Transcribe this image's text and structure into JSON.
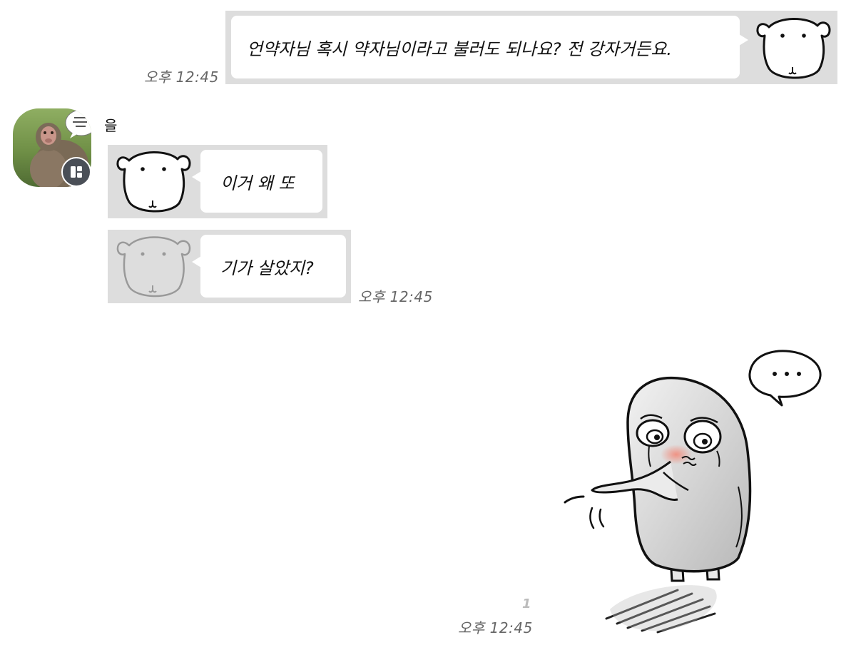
{
  "messages": {
    "outgoing_1": {
      "text": "언약자님 혹시 약자님이라고 불러도 되나요? 전 강자거든요.",
      "time": "오후 12:45"
    },
    "incoming": {
      "sender_name": "을",
      "message_1": "이거 왜 또",
      "message_2": "기가 살았지?",
      "time": "오후 12:45"
    },
    "sticker": {
      "unread_count": "1",
      "time": "오후 12:45"
    }
  },
  "colors": {
    "emote_background": "#dddddd",
    "bubble": "#ffffff",
    "timestamp": "#666666",
    "badge": "#4a4f57"
  },
  "icons": {
    "dog_face": "dog-face-emoticon",
    "profile": "monkey-photo-avatar",
    "badge": "profile-badge-icon",
    "sticker": "crying-ghost-sticker"
  }
}
